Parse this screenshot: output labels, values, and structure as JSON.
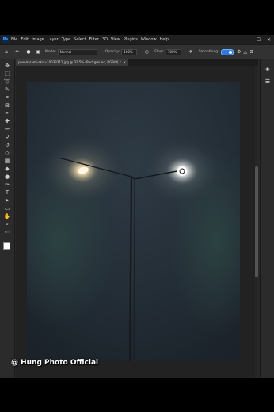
{
  "app": {
    "logo": "Ps",
    "menu": [
      "File",
      "Edit",
      "Image",
      "Layer",
      "Type",
      "Select",
      "Filter",
      "3D",
      "View",
      "Plugins",
      "Window",
      "Help"
    ],
    "window_controls": [
      "–",
      "☐",
      "✕"
    ]
  },
  "options": {
    "mode_label": "Mode:",
    "mode_value": "Normal",
    "opacity_label": "Opacity:",
    "opacity_value": "100%",
    "flow_label": "Flow:",
    "flow_value": "100%",
    "smoothing_label": "Smoothing:"
  },
  "document_tab": {
    "title": "pexels-sami-aksu-10033311.jpg @ 31.5% (Background, RGB/8) *",
    "close": "×"
  },
  "tools": [
    {
      "name": "move-tool-icon",
      "glyph": "✥"
    },
    {
      "name": "marquee-tool-icon",
      "glyph": "⬚"
    },
    {
      "name": "lasso-tool-icon",
      "glyph": "➰"
    },
    {
      "name": "quick-select-tool-icon",
      "glyph": "✎"
    },
    {
      "name": "crop-tool-icon",
      "glyph": "⌗"
    },
    {
      "name": "frame-tool-icon",
      "glyph": "⊠"
    },
    {
      "name": "eyedropper-tool-icon",
      "glyph": "✒"
    },
    {
      "name": "healing-brush-tool-icon",
      "glyph": "✚"
    },
    {
      "name": "brush-tool-icon",
      "glyph": "✏"
    },
    {
      "name": "clone-stamp-tool-icon",
      "glyph": "⚲"
    },
    {
      "name": "history-brush-tool-icon",
      "glyph": "↺"
    },
    {
      "name": "eraser-tool-icon",
      "glyph": "◇"
    },
    {
      "name": "gradient-tool-icon",
      "glyph": "▦"
    },
    {
      "name": "blur-tool-icon",
      "glyph": "◆"
    },
    {
      "name": "dodge-tool-icon",
      "glyph": "●"
    },
    {
      "name": "pen-tool-icon",
      "glyph": "✑"
    },
    {
      "name": "type-tool-icon",
      "glyph": "T"
    },
    {
      "name": "path-select-tool-icon",
      "glyph": "➤"
    },
    {
      "name": "shape-tool-icon",
      "glyph": "▭"
    },
    {
      "name": "hand-tool-icon",
      "glyph": "✋"
    },
    {
      "name": "zoom-tool-icon",
      "glyph": "⌕"
    },
    {
      "name": "edit-toolbar-icon",
      "glyph": "⋯"
    }
  ],
  "right_panel": [
    {
      "name": "layers-panel-icon",
      "glyph": "◈"
    },
    {
      "name": "properties-panel-icon",
      "glyph": "☰"
    }
  ],
  "watermark": "@ Hung Photo Official"
}
